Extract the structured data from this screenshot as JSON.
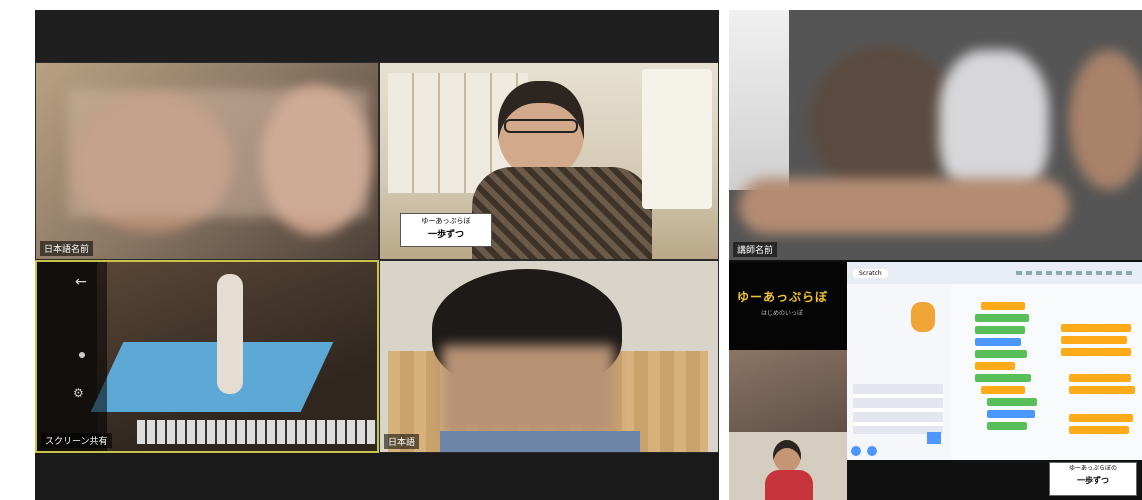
{
  "left_meeting": {
    "participants": [
      {
        "id": "p1",
        "name": "日本語名前"
      },
      {
        "id": "p2",
        "name": "",
        "sign_text": [
          "ゆーあっぷらぼ",
          "一歩ずつ"
        ]
      },
      {
        "id": "p3",
        "name": "スクリーン共有",
        "active": true
      },
      {
        "id": "p4",
        "name": "日本語"
      }
    ]
  },
  "right_meeting": {
    "main_participant": {
      "name": "講師名前"
    },
    "shared_screen": {
      "brand": "ゆーあっぷらぼ",
      "brand_sub": "はじめのいっぽ",
      "tab_label": "Scratch",
      "sign_text": [
        "ゆーあっぷらぼの",
        "一歩ずつ"
      ]
    }
  }
}
